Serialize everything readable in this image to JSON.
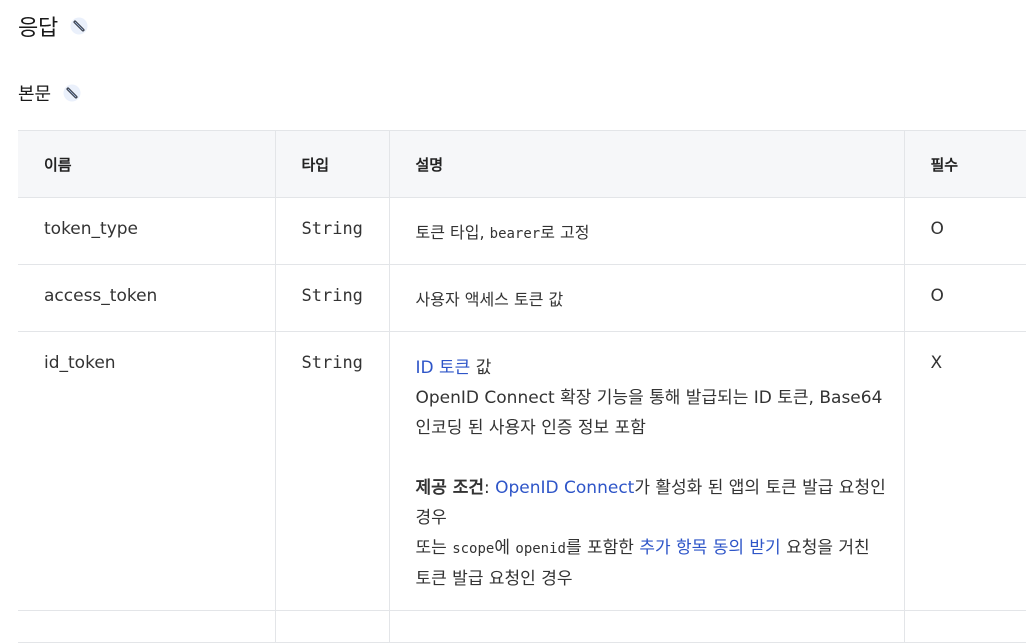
{
  "section": {
    "title": "응답",
    "anchor_icon": "link-icon"
  },
  "subsection": {
    "title": "본문",
    "anchor_icon": "link-icon"
  },
  "table": {
    "headers": [
      "이름",
      "타입",
      "설명",
      "필수"
    ],
    "rows": [
      {
        "name": "token_type",
        "type": "String",
        "desc_a": "토큰 타입, ",
        "desc_mono": "bearer",
        "desc_b": "로 고정",
        "required": "O"
      },
      {
        "name": "access_token",
        "type": "String",
        "desc": "사용자 액세스 토큰 값",
        "required": "O"
      },
      {
        "name": "id_token",
        "type": "String",
        "required": "X",
        "desc_link": "ID 토큰",
        "desc_after_link": " 값",
        "desc_line2": "OpenID Connect 확장 기능을 통해 발급되는 ID 토큰, Base64",
        "desc_line3": "인코딩 된 사용자 인증 정보 포함",
        "cond_label": "제공 조건",
        "cond_colon": ": ",
        "cond_link": "OpenID Connect",
        "cond_after": "가 활성화 된 앱의 토큰 발급 요청인",
        "cond_line2": "경우",
        "or_prefix": "또는 ",
        "or_scope": "scope",
        "or_mid": "에 ",
        "or_openid": "openid",
        "or_mid2": "를 포함한 ",
        "or_link": "추가 항목 동의 받기",
        "or_after": " 요청을 거친",
        "or_line2": "토큰 발급 요청인 경우"
      }
    ]
  }
}
